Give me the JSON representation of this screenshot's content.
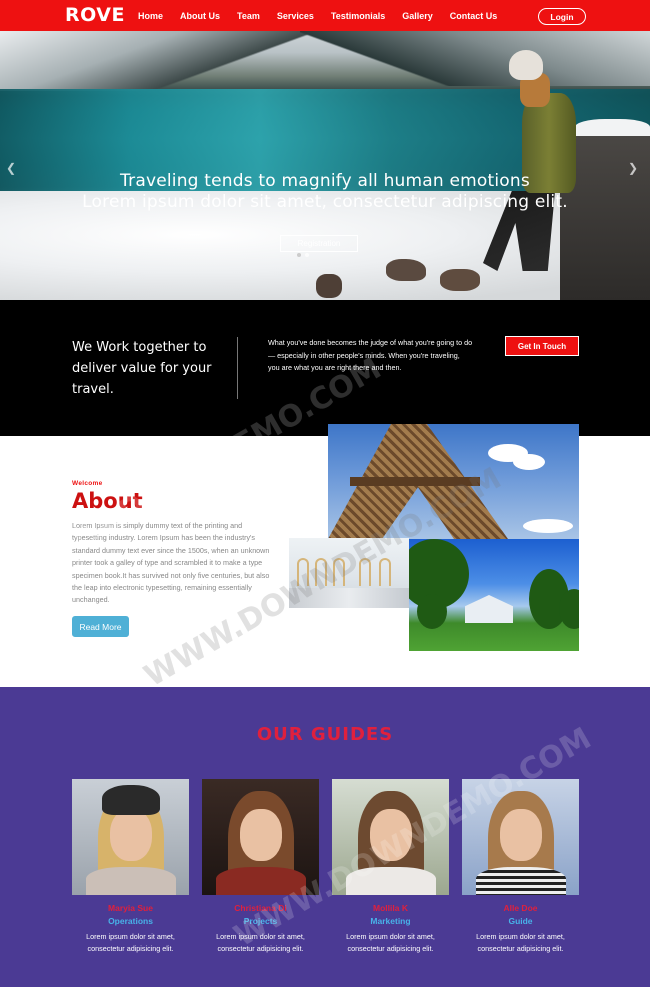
{
  "nav": {
    "logo": "ROVE",
    "items": [
      {
        "label": "Home"
      },
      {
        "label": "About Us"
      },
      {
        "label": "Team"
      },
      {
        "label": "Services"
      },
      {
        "label": "Testimonials"
      },
      {
        "label": "Gallery"
      },
      {
        "label": "Contact Us"
      }
    ],
    "login": "Login"
  },
  "hero": {
    "title_line1": "Traveling tends to magnify all human emotions",
    "title_line2": "Lorem ipsum dolor sit amet, consectetur adipiscing elit.",
    "button": "Registration",
    "prev_icon": "chevron-left-icon",
    "next_icon": "chevron-right-icon"
  },
  "band": {
    "title": "We Work together to deliver value for your travel.",
    "text": "What you've done becomes the judge of what you're going to do — especially in other people's minds. When you're traveling, you are what you are right there and then.",
    "button": "Get In Touch"
  },
  "about": {
    "welcome": "Welcome",
    "title": "About",
    "text": "Lorem Ipsum is simply dummy text of the printing and typesetting industry. Lorem Ipsum has been the industry's standard dummy text ever since the 1500s, when an unknown printer took a galley of type and scrambled it to make a type specimen book.It has survived not only five centuries, but also the leap into electronic typesetting, remaining essentially unchanged.",
    "button": "Read More"
  },
  "guides": {
    "title": "OUR GUIDES",
    "cards": [
      {
        "name": "Maryia Sue",
        "role": "Operations",
        "desc": "Lorem ipsum dolor sit amet, consectetur adipisicing elit."
      },
      {
        "name": "Christiana Di",
        "role": "Projects",
        "desc": "Lorem ipsum dolor sit amet, consectetur adipisicing elit."
      },
      {
        "name": "Mollila K",
        "role": "Marketing",
        "desc": "Lorem ipsum dolor sit amet, consectetur adipisicing elit."
      },
      {
        "name": "Alle Doe",
        "role": "Guide",
        "desc": "Lorem ipsum dolor sit amet, consectetur adipisicing elit."
      }
    ]
  },
  "watermark": "WWW.DOWNDEMO.COM",
  "colors": {
    "brand_red": "#ee1111",
    "guides_bg": "#4b3a94",
    "accent_blue": "#48b2e8",
    "readmore_bg": "#4fb0d6"
  }
}
